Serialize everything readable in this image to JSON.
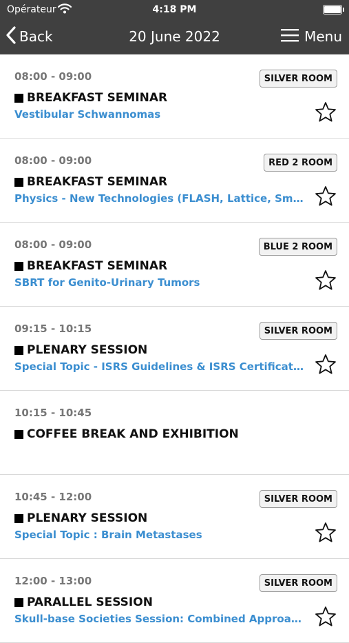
{
  "status_bar": {
    "carrier": "Opérateur",
    "time": "4:18 PM"
  },
  "nav": {
    "back_label": "Back",
    "title": "20 June 2022",
    "menu_label": "Menu"
  },
  "sessions": [
    {
      "time": "08:00 - 09:00",
      "room": "SILVER ROOM",
      "type": "BREAKFAST SEMINAR",
      "subtitle": "Vestibular Schwannomas"
    },
    {
      "time": "08:00 - 09:00",
      "room": "RED 2 ROOM",
      "type": "BREAKFAST SEMINAR",
      "subtitle": "Physics - New Technologies (FLASH, Lattice, Small..."
    },
    {
      "time": "08:00 - 09:00",
      "room": "BLUE 2 ROOM",
      "type": "BREAKFAST SEMINAR",
      "subtitle": "SBRT for Genito-Urinary Tumors"
    },
    {
      "time": "09:15 - 10:15",
      "room": "SILVER ROOM",
      "type": "PLENARY SESSION",
      "subtitle": "Special Topic - ISRS Guidelines & ISRS Certification..."
    },
    {
      "time": "10:15 - 10:45",
      "room": "",
      "type": "COFFEE BREAK AND EXHIBITION",
      "subtitle": ""
    },
    {
      "time": "10:45 - 12:00",
      "room": "SILVER ROOM",
      "type": "PLENARY SESSION",
      "subtitle": "Special Topic : Brain Metastases"
    },
    {
      "time": "12:00 - 13:00",
      "room": "SILVER ROOM",
      "type": "PARALLEL SESSION",
      "subtitle": "Skull-base Societies Session: Combined Approach..."
    }
  ]
}
